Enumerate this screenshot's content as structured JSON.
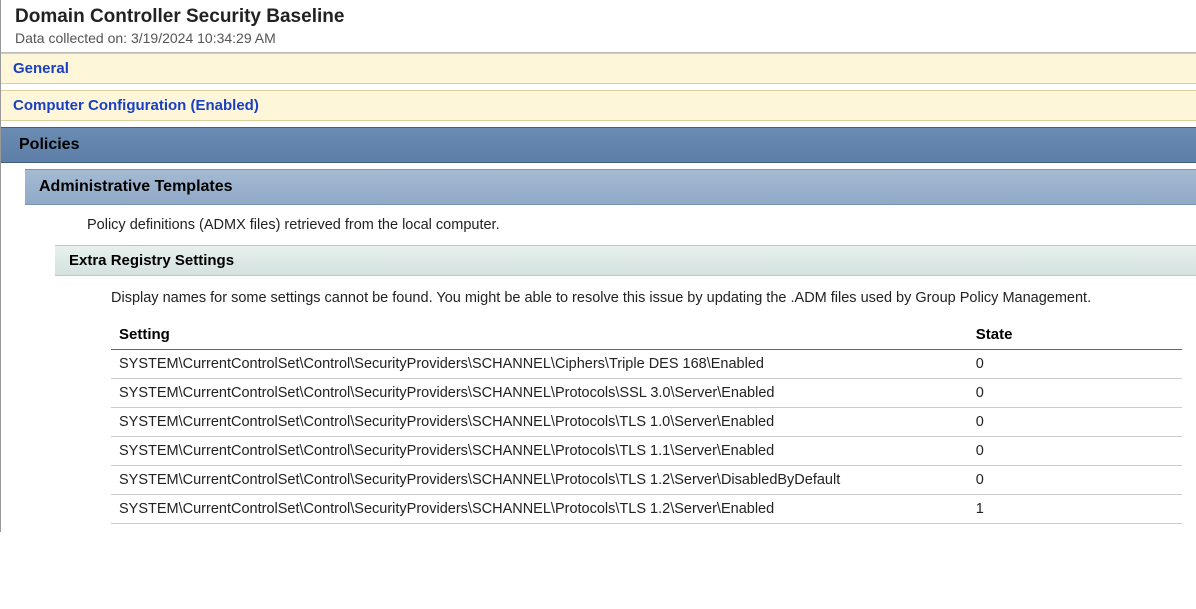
{
  "header": {
    "title": "Domain Controller Security Baseline",
    "collected_label": "Data collected on: 3/19/2024 10:34:29 AM"
  },
  "sections": {
    "general": "General",
    "computer_config": "Computer Configuration (Enabled)",
    "policies": "Policies",
    "admin_templates": "Administrative Templates",
    "policy_note": "Policy definitions (ADMX files) retrieved from the local computer.",
    "extra_registry": "Extra Registry Settings",
    "display_names_note": "Display names for some settings cannot be found. You might be able to resolve this issue by updating the .ADM files used by Group Policy Management."
  },
  "table": {
    "headers": {
      "setting": "Setting",
      "state": "State"
    },
    "rows": [
      {
        "setting": "SYSTEM\\CurrentControlSet\\Control\\SecurityProviders\\SCHANNEL\\Ciphers\\Triple DES 168\\Enabled",
        "state": "0"
      },
      {
        "setting": "SYSTEM\\CurrentControlSet\\Control\\SecurityProviders\\SCHANNEL\\Protocols\\SSL 3.0\\Server\\Enabled",
        "state": "0"
      },
      {
        "setting": "SYSTEM\\CurrentControlSet\\Control\\SecurityProviders\\SCHANNEL\\Protocols\\TLS 1.0\\Server\\Enabled",
        "state": "0"
      },
      {
        "setting": "SYSTEM\\CurrentControlSet\\Control\\SecurityProviders\\SCHANNEL\\Protocols\\TLS 1.1\\Server\\Enabled",
        "state": "0"
      },
      {
        "setting": "SYSTEM\\CurrentControlSet\\Control\\SecurityProviders\\SCHANNEL\\Protocols\\TLS 1.2\\Server\\DisabledByDefault",
        "state": "0"
      },
      {
        "setting": "SYSTEM\\CurrentControlSet\\Control\\SecurityProviders\\SCHANNEL\\Protocols\\TLS 1.2\\Server\\Enabled",
        "state": "1"
      }
    ]
  }
}
